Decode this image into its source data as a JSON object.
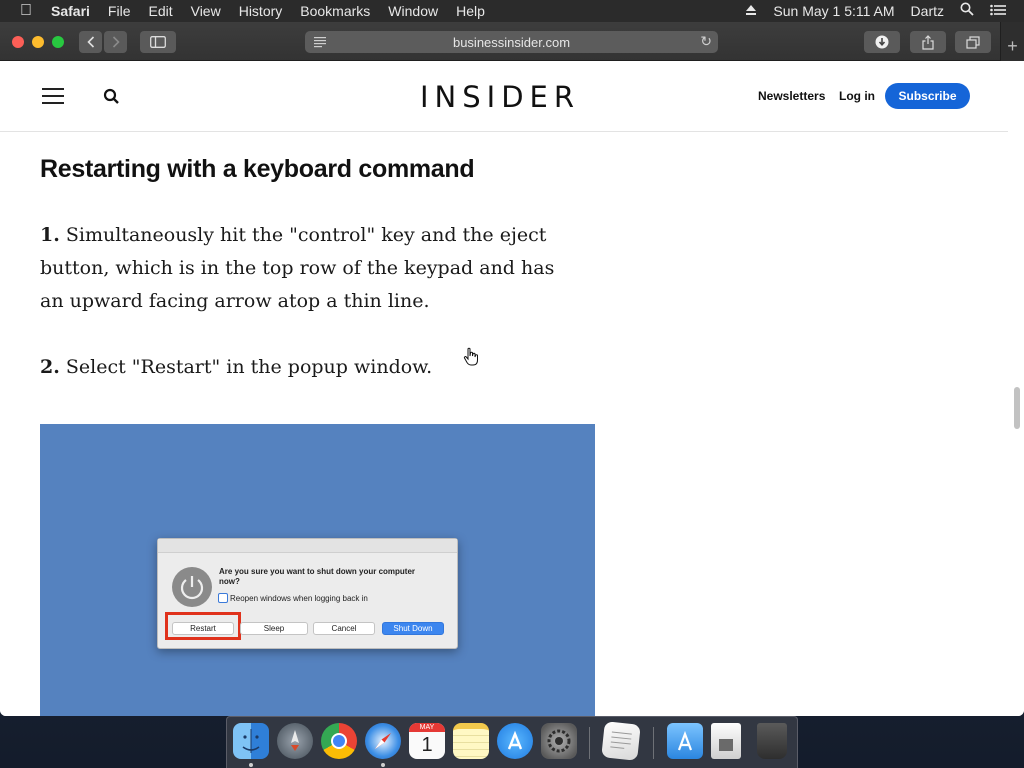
{
  "menubar": {
    "app_name": "Safari",
    "menus": [
      "File",
      "Edit",
      "View",
      "History",
      "Bookmarks",
      "Window",
      "Help"
    ],
    "clock": "Sun May 1  5:11 AM",
    "user": "Dartz"
  },
  "browser": {
    "url": "businessinsider.com"
  },
  "site": {
    "logo": "INSIDER",
    "nav_newsletters": "Newsletters",
    "nav_login": "Log in",
    "subscribe": "Subscribe"
  },
  "article": {
    "heading": "Restarting with a keyboard command",
    "steps": [
      {
        "num": "1.",
        "text": "Simultaneously hit the \"control\" key and the eject button, which is in the top row of the keypad and has an upward facing arrow atop a thin line."
      },
      {
        "num": "2.",
        "text": "Select \"Restart\" in the popup window."
      }
    ]
  },
  "image_dialog": {
    "question": "Are you sure you want to shut down your computer now?",
    "checkbox_label": "Reopen windows when logging back in",
    "buttons": {
      "restart": "Restart",
      "sleep": "Sleep",
      "cancel": "Cancel",
      "shutdown": "Shut Down"
    },
    "highlight_color": "#e0321c"
  },
  "dock": {
    "items": [
      "finder-icon",
      "launchpad-icon",
      "chrome-icon",
      "safari-icon",
      "calendar-icon",
      "notes-icon",
      "app-store-icon",
      "system-preferences-icon",
      "textedit-icon",
      "applications-folder-icon",
      "downloads-icon",
      "trash-icon"
    ],
    "calendar_month": "MAY",
    "calendar_day": "1"
  },
  "colors": {
    "subscribe_button": "#1565d8",
    "image_background": "#5582bf"
  }
}
